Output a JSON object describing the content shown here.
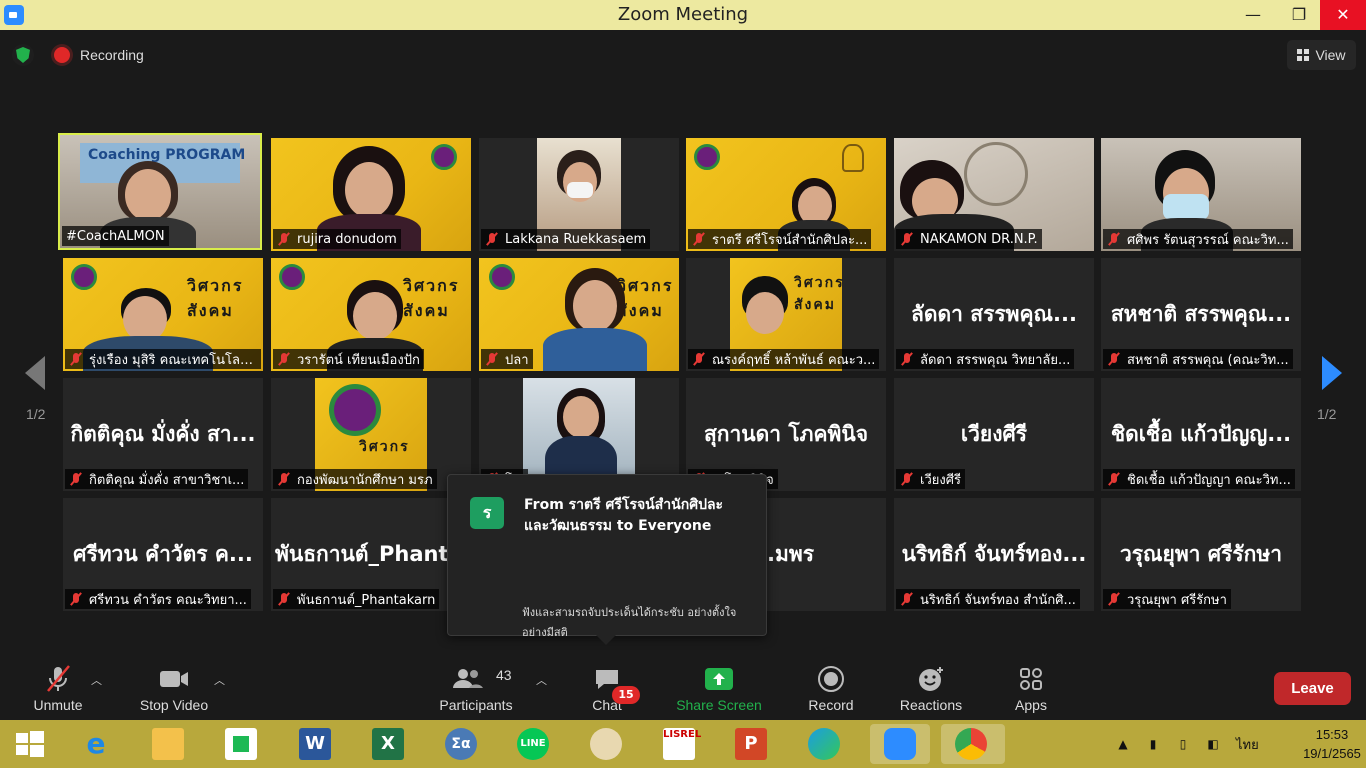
{
  "window": {
    "title": "Zoom Meeting"
  },
  "topbar": {
    "recording_label": "Recording",
    "view_label": "View"
  },
  "pagination": {
    "left": "1/2",
    "right": "1/2"
  },
  "participants": [
    {
      "name": "#CoachALMON",
      "muted": false,
      "display": "Coaching PROGRAM"
    },
    {
      "name": "rujira donudom",
      "muted": true,
      "display": ""
    },
    {
      "name": "Lakkana Ruekkasaem",
      "muted": true,
      "display": ""
    },
    {
      "name": "ราตรี  ศรีโรจน์สำนักศิปละ...",
      "muted": true,
      "display": ""
    },
    {
      "name": "NAKAMON DR.N.P.",
      "muted": true,
      "display": ""
    },
    {
      "name": "ศศิพร รัตนสุวรรณ์ คณะวิท...",
      "muted": true,
      "display": ""
    },
    {
      "name": "รุ่งเรือง มุสิริ คณะเทคโนโลยี...",
      "muted": true,
      "display": "วิศวกรสังคม"
    },
    {
      "name": "วรารัตน์ เทียนเมืองปัก",
      "muted": true,
      "display": "วิศวกรสังคม"
    },
    {
      "name": "ปลา",
      "muted": true,
      "display": "วิศวกรสังคม"
    },
    {
      "name": "ณรงค์ฤทธิ์ หล้าพันธ์ คณะว...",
      "muted": true,
      "display": "วิศวกรสังคม"
    },
    {
      "name": "ลัดดา สรรพคุณ  วิทยาลัย...",
      "muted": true,
      "display": "ลัดดา สรรพคุณ..."
    },
    {
      "name": "สหชาติ สรรพคุณ (คณะวิท...",
      "muted": true,
      "display": "สหชาติ สรรพคุณ..."
    },
    {
      "name": "กิตติคุณ  มั่งคั่ง สาขาวิชาเ...",
      "muted": true,
      "display": "กิตติคุณ  มั่งคั่ง สา..."
    },
    {
      "name": "กองพัฒนานักศึกษา มรภ",
      "muted": true,
      "display": "วิศวกร"
    },
    {
      "name": "โ...",
      "muted": true,
      "display": ""
    },
    {
      "name": "...โภคพินิจ",
      "muted": true,
      "display": "สุกานดา โภคพินิจ"
    },
    {
      "name": "เวียงศีรี",
      "muted": true,
      "display": "เวียงศีรี"
    },
    {
      "name": "ชิดเชื้อ แก้วปัญญา คณะวิท...",
      "muted": true,
      "display": "ชิดเชื้อ แก้วปัญญ..."
    },
    {
      "name": "ศรีทวน  คำวัตร คณะวิทยา...",
      "muted": true,
      "display": "ศรีทวน  คำวัตร ค..."
    },
    {
      "name": "พันธกานต์_Phantakarn",
      "muted": true,
      "display": "พันธกานต์_Phant..."
    },
    {
      "name": "",
      "muted": true,
      "display": "...มพร"
    },
    {
      "name": "",
      "muted": true,
      "display": ""
    },
    {
      "name": "นริทธิก์ จันทร์ทอง สำนักศิ...",
      "muted": true,
      "display": "นริทธิก์ จันทร์ทอง..."
    },
    {
      "name": "วรุณยุพา ศรีรักษา",
      "muted": true,
      "display": "วรุณยุพา ศรีรักษา"
    }
  ],
  "chat_popup": {
    "avatar": "ร",
    "from": "From ราตรี  ศรีโรจน์สำนักศิปละและวัฒนธรรม to Everyone",
    "message": "ฟังและสามรถจับประเด็นได้กระชับ อย่างตั้งใจ อย่างมีสติ"
  },
  "toolbar": {
    "unmute": "Unmute",
    "stop_video": "Stop Video",
    "participants": "Participants",
    "participants_count": "43",
    "chat": "Chat",
    "chat_badge": "15",
    "share_screen": "Share Screen",
    "record": "Record",
    "reactions": "Reactions",
    "apps": "Apps",
    "leave": "Leave"
  },
  "taskbar": {
    "lang": "ไทย",
    "time": "15:53",
    "date": "19/1/2565"
  },
  "colors": {
    "accent": "#2d8cff",
    "share_green": "#22b14c",
    "leave_red": "#c0282a",
    "taskbar": "#b8a83c"
  }
}
